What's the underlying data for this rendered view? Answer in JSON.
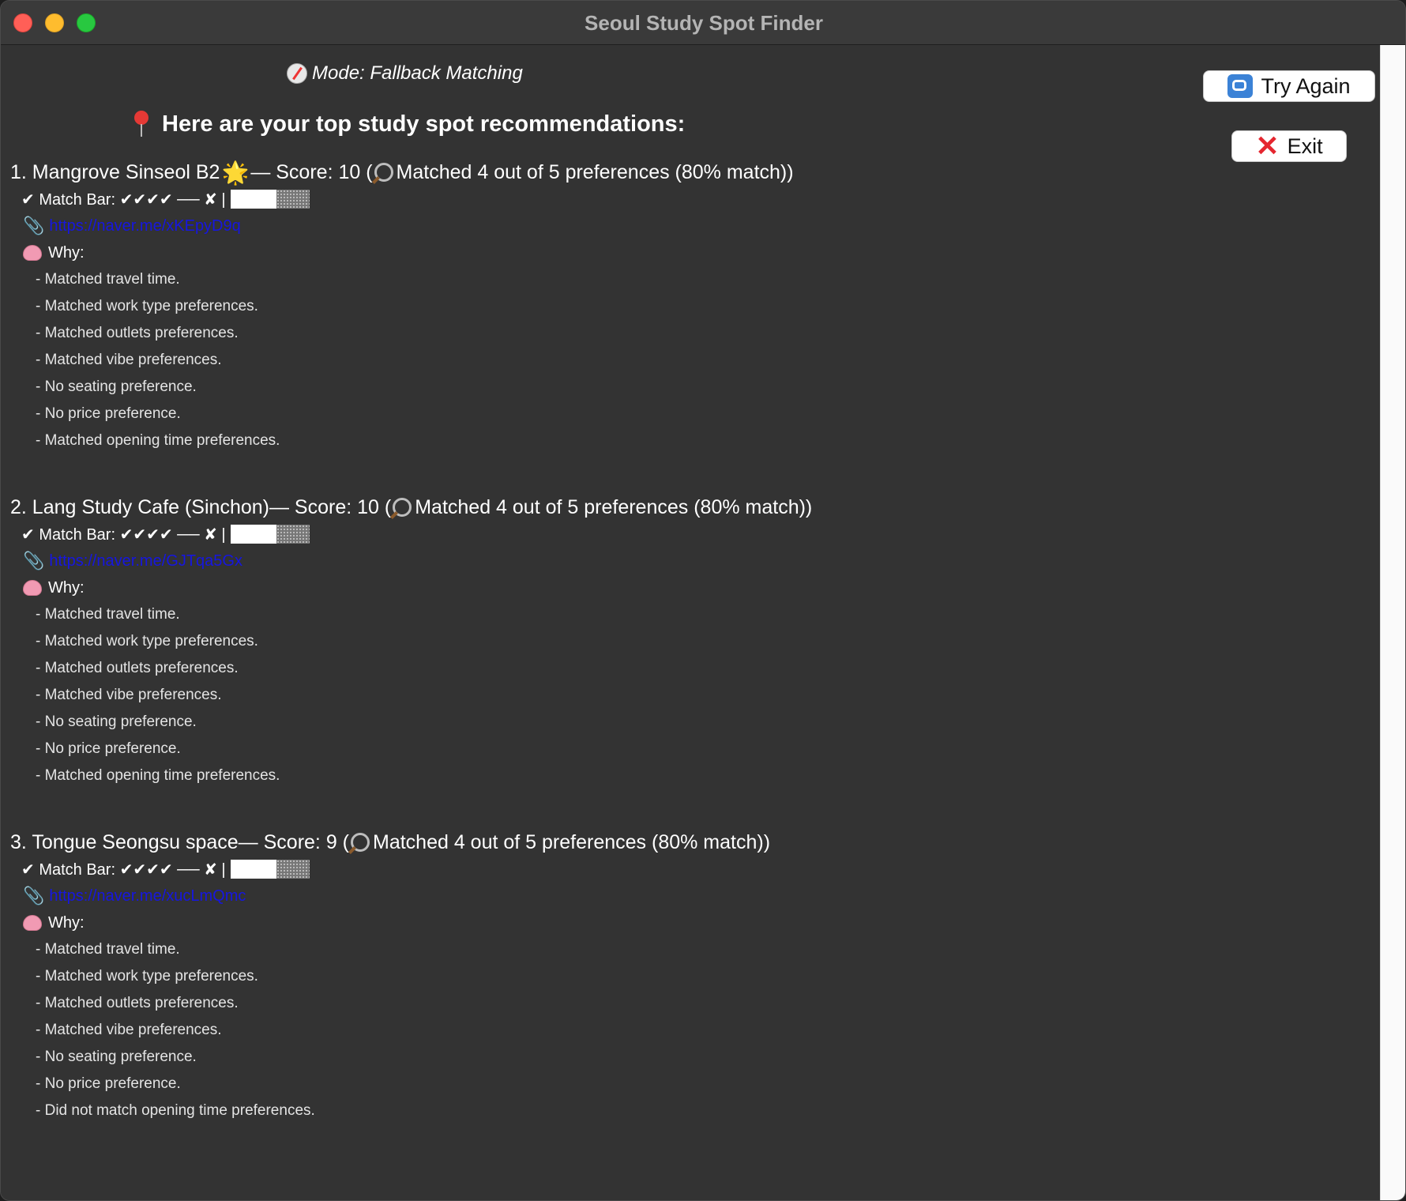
{
  "window": {
    "title": "Seoul Study Spot Finder"
  },
  "mode": {
    "icon": "compass-icon",
    "label": "Mode: Fallback Matching"
  },
  "heading": {
    "icon": "round-pushpin-icon",
    "text": "Here are your top study spot recommendations:"
  },
  "buttons": {
    "try_again": {
      "icon": "repeat-icon",
      "label": "Try Again"
    },
    "exit": {
      "icon": "cross-mark-icon",
      "label": "Exit"
    }
  },
  "labels": {
    "match_bar": "✔ Match Bar:",
    "why": "Why:"
  },
  "spots": [
    {
      "prefix": "1. Mangrove Sinseol B2",
      "badge": "🌟",
      "score_text": " — Score: 10 (",
      "match_text": "Matched 4 out of 5 preferences (80% match))",
      "match_glyphs": "✔✔✔✔ ── ✘ |",
      "match_fraction": 0.8,
      "url": "https://naver.me/xKEpyD9q",
      "reasons": [
        "- Matched travel time.",
        "- Matched work type preferences.",
        "- Matched outlets preferences.",
        "- Matched vibe preferences.",
        "- No seating preference.",
        "- No price preference.",
        "- Matched opening time preferences."
      ]
    },
    {
      "prefix": "2. Lang Study Cafe (Sinchon)",
      "badge": "",
      "score_text": " — Score: 10 (",
      "match_text": "Matched 4 out of 5 preferences (80% match))",
      "match_glyphs": "✔✔✔✔ ── ✘ |",
      "match_fraction": 0.8,
      "url": "https://naver.me/GJTqa5Gx",
      "reasons": [
        "- Matched travel time.",
        "- Matched work type preferences.",
        "- Matched outlets preferences.",
        "- Matched vibe preferences.",
        "- No seating preference.",
        "- No price preference.",
        "- Matched opening time preferences."
      ]
    },
    {
      "prefix": "3. Tongue Seongsu space",
      "badge": "",
      "score_text": " — Score: 9 (",
      "match_text": "Matched 4 out of 5 preferences (80% match))",
      "match_glyphs": "✔✔✔✔ ── ✘ |",
      "match_fraction": 0.8,
      "url": "https://naver.me/xucLmQmc",
      "reasons": [
        "- Matched travel time.",
        "- Matched work type preferences.",
        "- Matched outlets preferences.",
        "- Matched vibe preferences.",
        "- No seating preference.",
        "- No price preference.",
        "- Did not match opening time preferences."
      ]
    }
  ],
  "colors": {
    "background": "#333333",
    "link": "#1616e0",
    "text": "#ffffff"
  }
}
